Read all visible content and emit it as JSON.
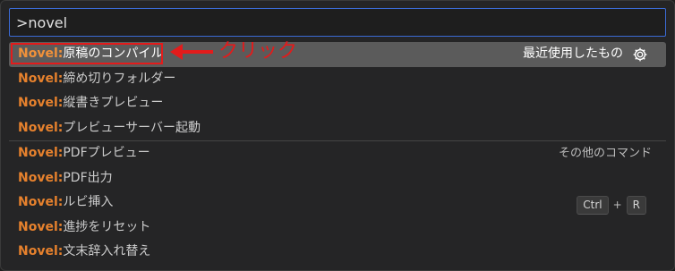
{
  "search": {
    "value": ">novel",
    "placeholder": ""
  },
  "rows": [
    {
      "prefix": "Novel:",
      "text": "原稿のコンパイル"
    },
    {
      "prefix": "Novel:",
      "text": "締め切りフォルダー"
    },
    {
      "prefix": "Novel:",
      "text": "縦書きプレビュー"
    },
    {
      "prefix": "Novel:",
      "text": "プレビューサーバー起動"
    },
    {
      "prefix": "Novel:",
      "text": "PDFプレビュー"
    },
    {
      "prefix": "Novel:",
      "text": "PDF出力"
    },
    {
      "prefix": "Novel:",
      "text": "ルビ挿入"
    },
    {
      "prefix": "Novel:",
      "text": "進捗をリセット"
    },
    {
      "prefix": "Novel:",
      "text": "文末辞入れ替え"
    }
  ],
  "recently_used_label": "最近使用したもの",
  "other_commands_label": "その他のコマンド",
  "keybinding": {
    "key1": "Ctrl",
    "plus": "+",
    "key2": "R"
  },
  "annotation": {
    "text": "クリック"
  },
  "icons": {
    "settings": "gear-icon",
    "arrow": "left-arrow-icon"
  },
  "colors": {
    "prefix": "#e6812d",
    "annotation": "#e31b1b",
    "selected_bg": "#5b5b5b",
    "focus_border": "#3b6bd6"
  }
}
